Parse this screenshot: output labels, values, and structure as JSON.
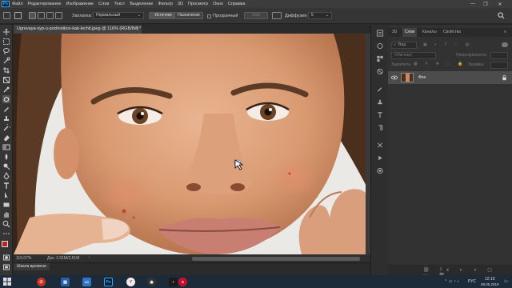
{
  "menu": {
    "app_logo": "Ps",
    "items": [
      "Файл",
      "Редактирование",
      "Изображение",
      "Слои",
      "Текст",
      "Выделение",
      "Фильтр",
      "3D",
      "Просмотр",
      "Окно",
      "Справка"
    ],
    "window_controls": [
      "—",
      "❐",
      "✕"
    ]
  },
  "options": {
    "mode_label": "Заплатка:",
    "mode_value": "Нормальный",
    "source_button": "Источник",
    "dest_button": "Назначение",
    "transparent_label": "Прозрачный",
    "pattern_button": "Узор",
    "diffusion_label": "Диффузия:",
    "diffusion_value": "5"
  },
  "document": {
    "tab_title": "Ugrevaya-syp-u-podrostkov-kak-lechit.jpeg @ 116% (RGB/8#) *",
    "zoom": "116,07%",
    "doc_size": "Док: 2,61М/2,61М",
    "timeline_tab": "Шкала времени"
  },
  "panel": {
    "tabs": [
      "3D",
      "Слои",
      "Каналы",
      "Свойства"
    ],
    "filter_label": "Вид",
    "blend_mode": "Обычные",
    "opacity_label": "Непрозрачность:",
    "lock_label": "Закрепить:",
    "fill_label": "Заливка:",
    "layer_name": "Фон"
  },
  "taskbar": {
    "time": "12:19",
    "date": "08.05.2019",
    "lang": "РУС"
  },
  "colors": {
    "accent": "#31a8ff",
    "menubar": "#3c3c3c",
    "panel": "#323232",
    "taskbar": "#1c2a3a"
  }
}
